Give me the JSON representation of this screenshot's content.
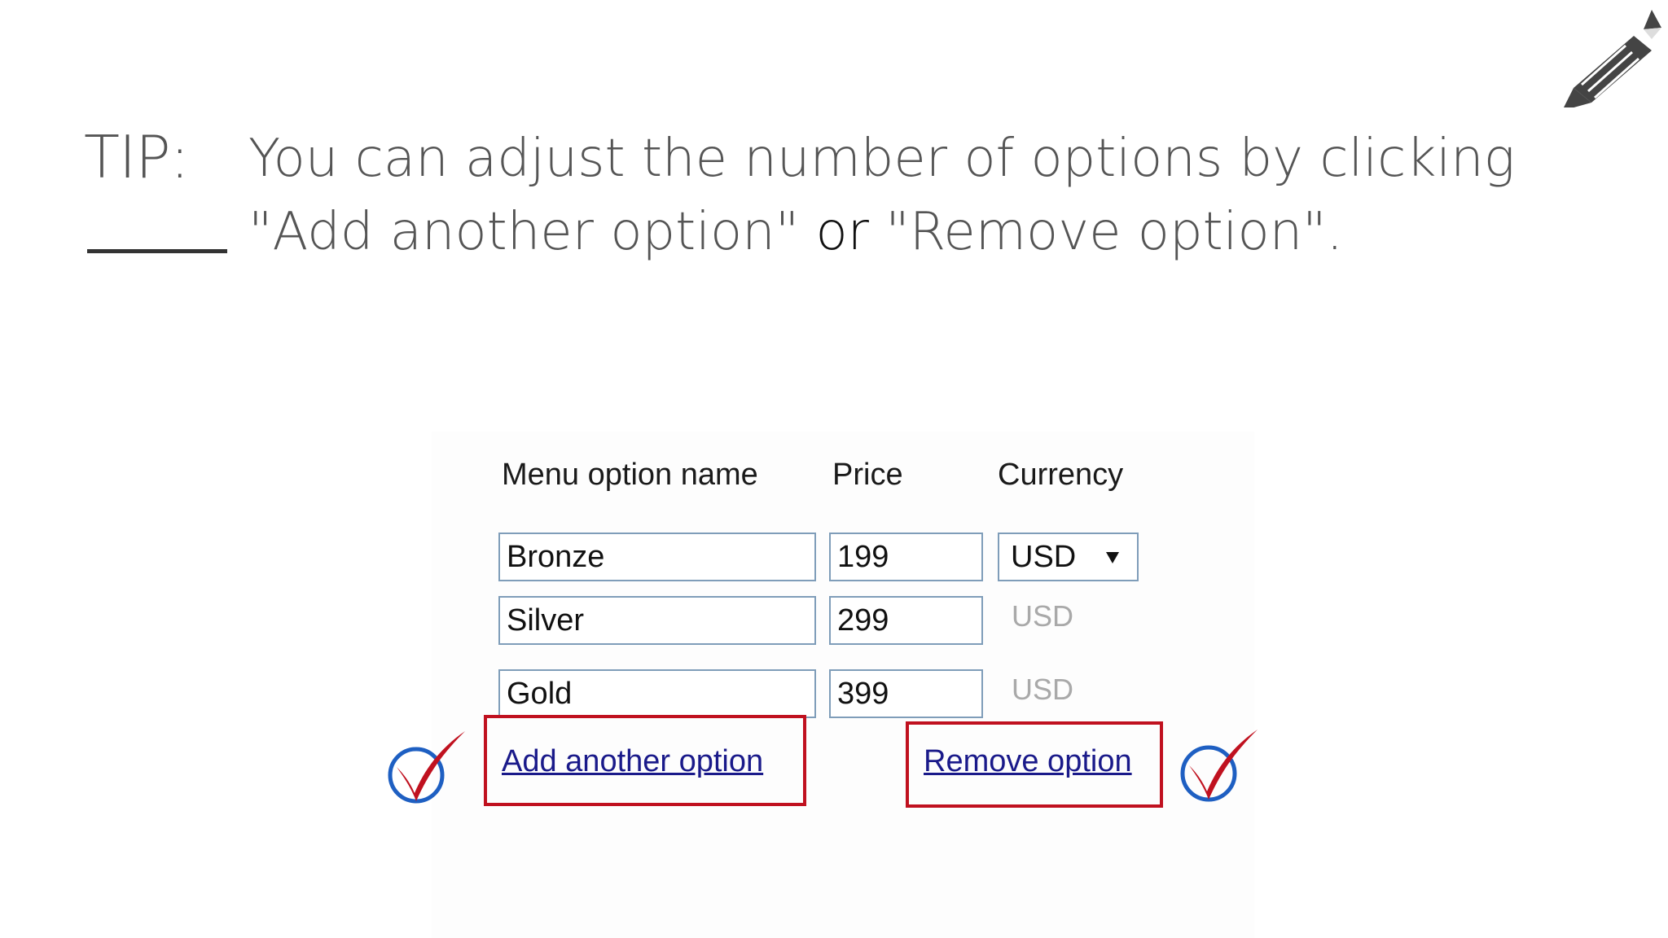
{
  "tip": {
    "label": "TIP:",
    "line1": "You can adjust the number of options by clicking",
    "line2_part1": "\"Add another option\"",
    "line2_or": " or ",
    "line2_part2": "\"Remove option\"."
  },
  "icons": {
    "pencil": "pencil-icon",
    "check": "check-circle-icon"
  },
  "form": {
    "headers": {
      "name": "Menu option name",
      "price": "Price",
      "currency": "Currency"
    },
    "rows": [
      {
        "name": "Bronze",
        "price": "199",
        "currency": "USD"
      },
      {
        "name": "Silver",
        "price": "299",
        "currency": "USD"
      },
      {
        "name": "Gold",
        "price": "399",
        "currency": "USD"
      }
    ],
    "add_link": "Add another option",
    "remove_link": "Remove option"
  },
  "colors": {
    "highlight": "#c0111f",
    "check_red": "#c0111f",
    "check_blue": "#1e5fc2",
    "link": "#1a1a8a",
    "field_border": "#7f9db9"
  }
}
